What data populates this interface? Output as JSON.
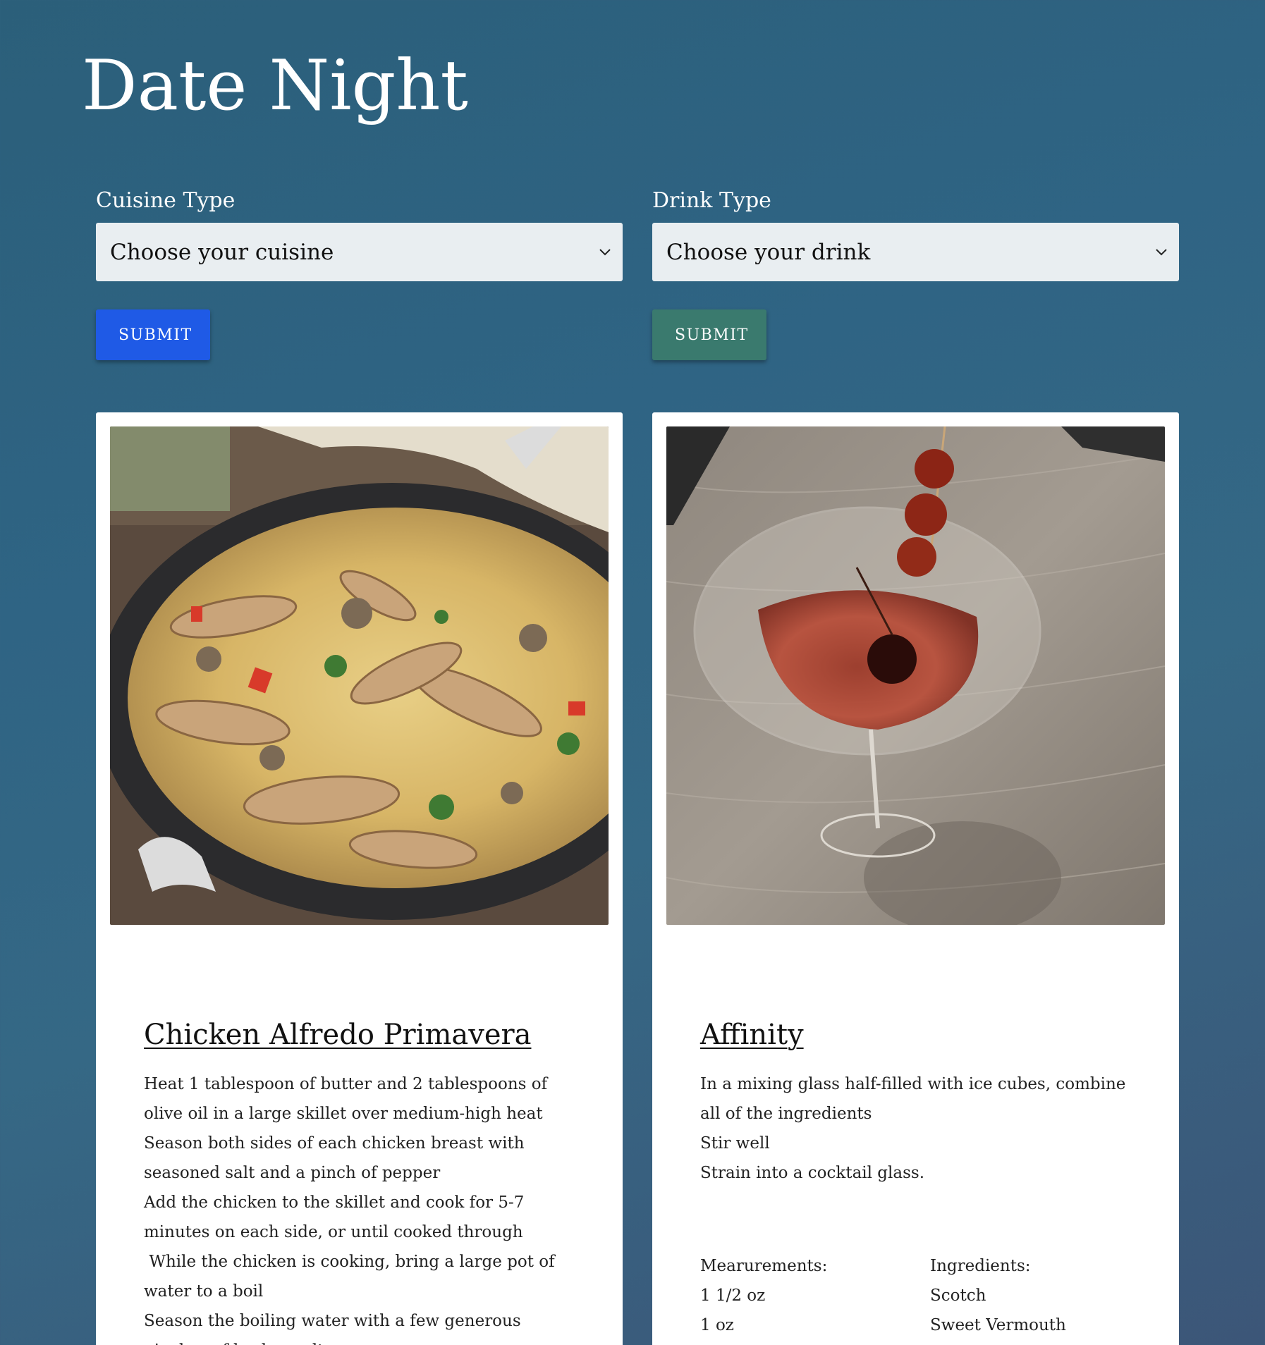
{
  "page": {
    "title": "Date Night"
  },
  "cuisine": {
    "label": "Cuisine Type",
    "selected": "Choose your cuisine",
    "submit_label": "SUBMIT"
  },
  "drink": {
    "label": "Drink Type",
    "selected": "Choose your drink",
    "submit_label": "SUBMIT"
  },
  "colors": {
    "background": "#2f6484",
    "submit_cuisine": "#1f5ae6",
    "submit_drink": "#3a7a6e",
    "select_bg": "#e9eef1"
  },
  "food_card": {
    "image_icon": "pasta-skillet-photo",
    "title": "Chicken Alfredo Primavera",
    "steps": [
      "Heat 1 tablespoon of butter and 2 tablespoons of olive oil in a large skillet over medium-high heat",
      "Season both sides of each chicken breast with seasoned salt and a pinch of pepper",
      "Add the chicken to the skillet and cook for 5-7 minutes on each side, or until cooked through",
      " While the chicken is cooking, bring a large pot of water to a boil",
      "Season the boiling water with a few generous pinches of kosher salt"
    ]
  },
  "drink_card": {
    "image_icon": "cocktail-glass-photo",
    "title": "Affinity",
    "steps": [
      "In a mixing glass half-filled with ice cubes, combine all of the ingredients",
      "Stir well",
      "Strain into a cocktail glass."
    ],
    "measurements_header": "Mearurements:",
    "ingredients_header": "Ingredients:",
    "measurements": [
      "1 1/2 oz",
      "1 oz"
    ],
    "ingredients": [
      "Scotch",
      "Sweet Vermouth"
    ]
  }
}
